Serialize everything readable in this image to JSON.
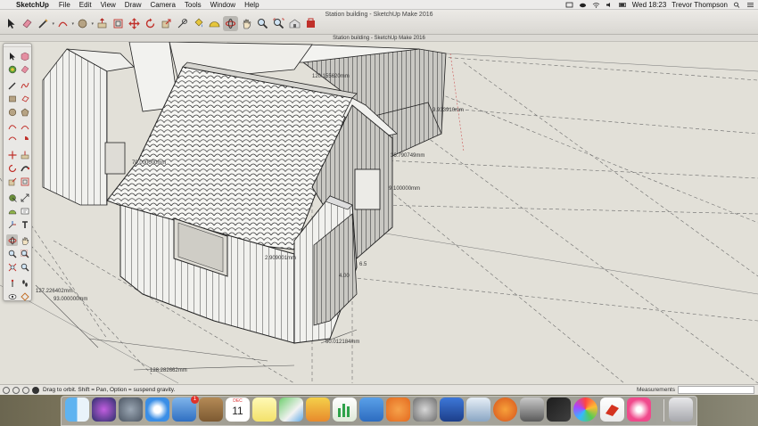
{
  "menubar": {
    "app_name": "SketchUp",
    "items": [
      "File",
      "Edit",
      "View",
      "Draw",
      "Camera",
      "Tools",
      "Window",
      "Help"
    ],
    "clock": "Wed 18:23",
    "user": "Trevor Thompson"
  },
  "window": {
    "title": "Station building - SketchUp Make 2016",
    "subtitle": "Station building - SketchUp Make 2016"
  },
  "toolbar": {
    "tools": [
      "select-icon",
      "eraser-icon",
      "lasso-icon",
      "paint-bucket-icon",
      "tape-measure-icon",
      "move-icon",
      "rotate-icon",
      "push-pull-icon",
      "offset-icon",
      "paint-icon",
      "orbit-icon",
      "pan-icon",
      "zoom-icon",
      "zoom-extents-icon",
      "warehouse-icon",
      "extension-icon",
      "layout-icon"
    ]
  },
  "dimensions": {
    "d1": "120.155620mm",
    "d2": "9.933910mm",
    "d3": "70.000000mm",
    "d4": "36.790749mm",
    "d5": "9.100000mm",
    "d6": "2.909001mm",
    "d7": "127.226402mm",
    "d8": "93.000000mm",
    "d9": "60.012184mm",
    "d10": "128.282662mm",
    "d11": "4.00",
    "d12": "6.5"
  },
  "statusbar": {
    "hint": "Drag to orbit. Shift = Pan, Option = suspend gravity.",
    "measurements_label": "Measurements",
    "measurements_value": ""
  },
  "dock": {
    "calendar_month": "DEC",
    "calendar_day": "11",
    "mail_badge": "1",
    "apps": [
      "Finder",
      "Siri",
      "Launchpad",
      "Safari",
      "Mail",
      "Notes",
      "Calendar",
      "Stickies",
      "Maps",
      "Photos",
      "Numbers",
      "Keynote",
      "Books",
      "System Preferences",
      "Remote Desktop",
      "Preview",
      "iStudio",
      "Sublime",
      "Final Cut",
      "Photo Booth",
      "SketchUp",
      "iTunes",
      "Trash"
    ]
  },
  "colors": {
    "canvas": "#e2e0d8",
    "accent": "#d4321f"
  }
}
